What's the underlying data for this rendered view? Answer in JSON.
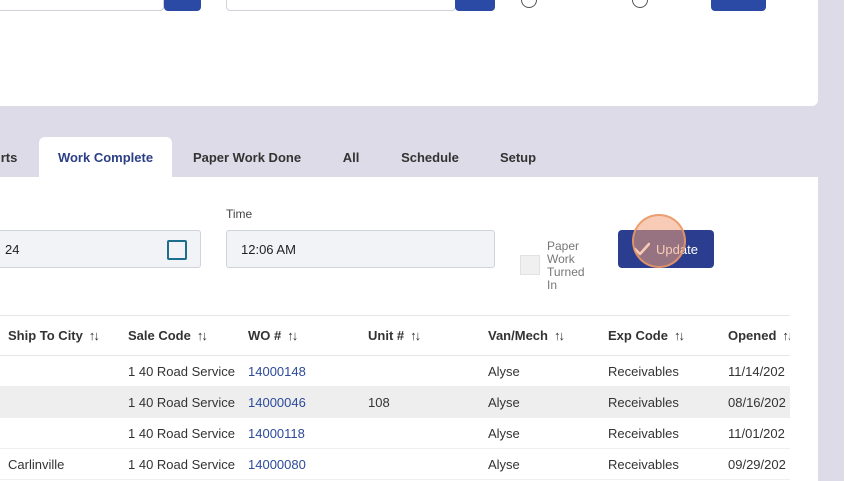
{
  "tabs": [
    {
      "label": "rts",
      "active": false
    },
    {
      "label": "Work Complete",
      "active": true
    },
    {
      "label": "Paper Work Done",
      "active": false
    },
    {
      "label": "All",
      "active": false
    },
    {
      "label": "Schedule",
      "active": false
    },
    {
      "label": "Setup",
      "active": false
    }
  ],
  "form": {
    "date_value": "24",
    "time_label": "Time",
    "time_value": "12:06 AM",
    "paper_work_label": "Paper Work Turned In",
    "paper_work_lines": [
      "Paper",
      "Work",
      "Turned",
      "In"
    ],
    "paper_work_checked": false,
    "update_label": "Update"
  },
  "table": {
    "columns": [
      "Ship To City",
      "Sale Code",
      "WO #",
      "Unit #",
      "Van/Mech",
      "Exp Code",
      "Opened"
    ],
    "sort_icon": "sort-arrows-icon",
    "rows": [
      {
        "city": "",
        "sale_code": "1 40 Road Service",
        "wo": "14000148",
        "unit": "",
        "van_mech": "Alyse",
        "exp_code": "Receivables",
        "opened": "11/14/202"
      },
      {
        "city": "",
        "sale_code": "1 40 Road Service",
        "wo": "14000046",
        "unit": "108",
        "van_mech": "Alyse",
        "exp_code": "Receivables",
        "opened": "08/16/202"
      },
      {
        "city": "",
        "sale_code": "1 40 Road Service",
        "wo": "14000118",
        "unit": "",
        "van_mech": "Alyse",
        "exp_code": "Receivables",
        "opened": "11/01/202"
      },
      {
        "city": "Carlinville",
        "sale_code": "1 40 Road Service",
        "wo": "14000080",
        "unit": "",
        "van_mech": "Alyse",
        "exp_code": "Receivables",
        "opened": "09/29/202"
      }
    ]
  },
  "colors": {
    "accent": "#2a3d8f",
    "link": "#2d4a9b",
    "background": "#dcdbe7",
    "row_highlight": "#eeeeee"
  }
}
